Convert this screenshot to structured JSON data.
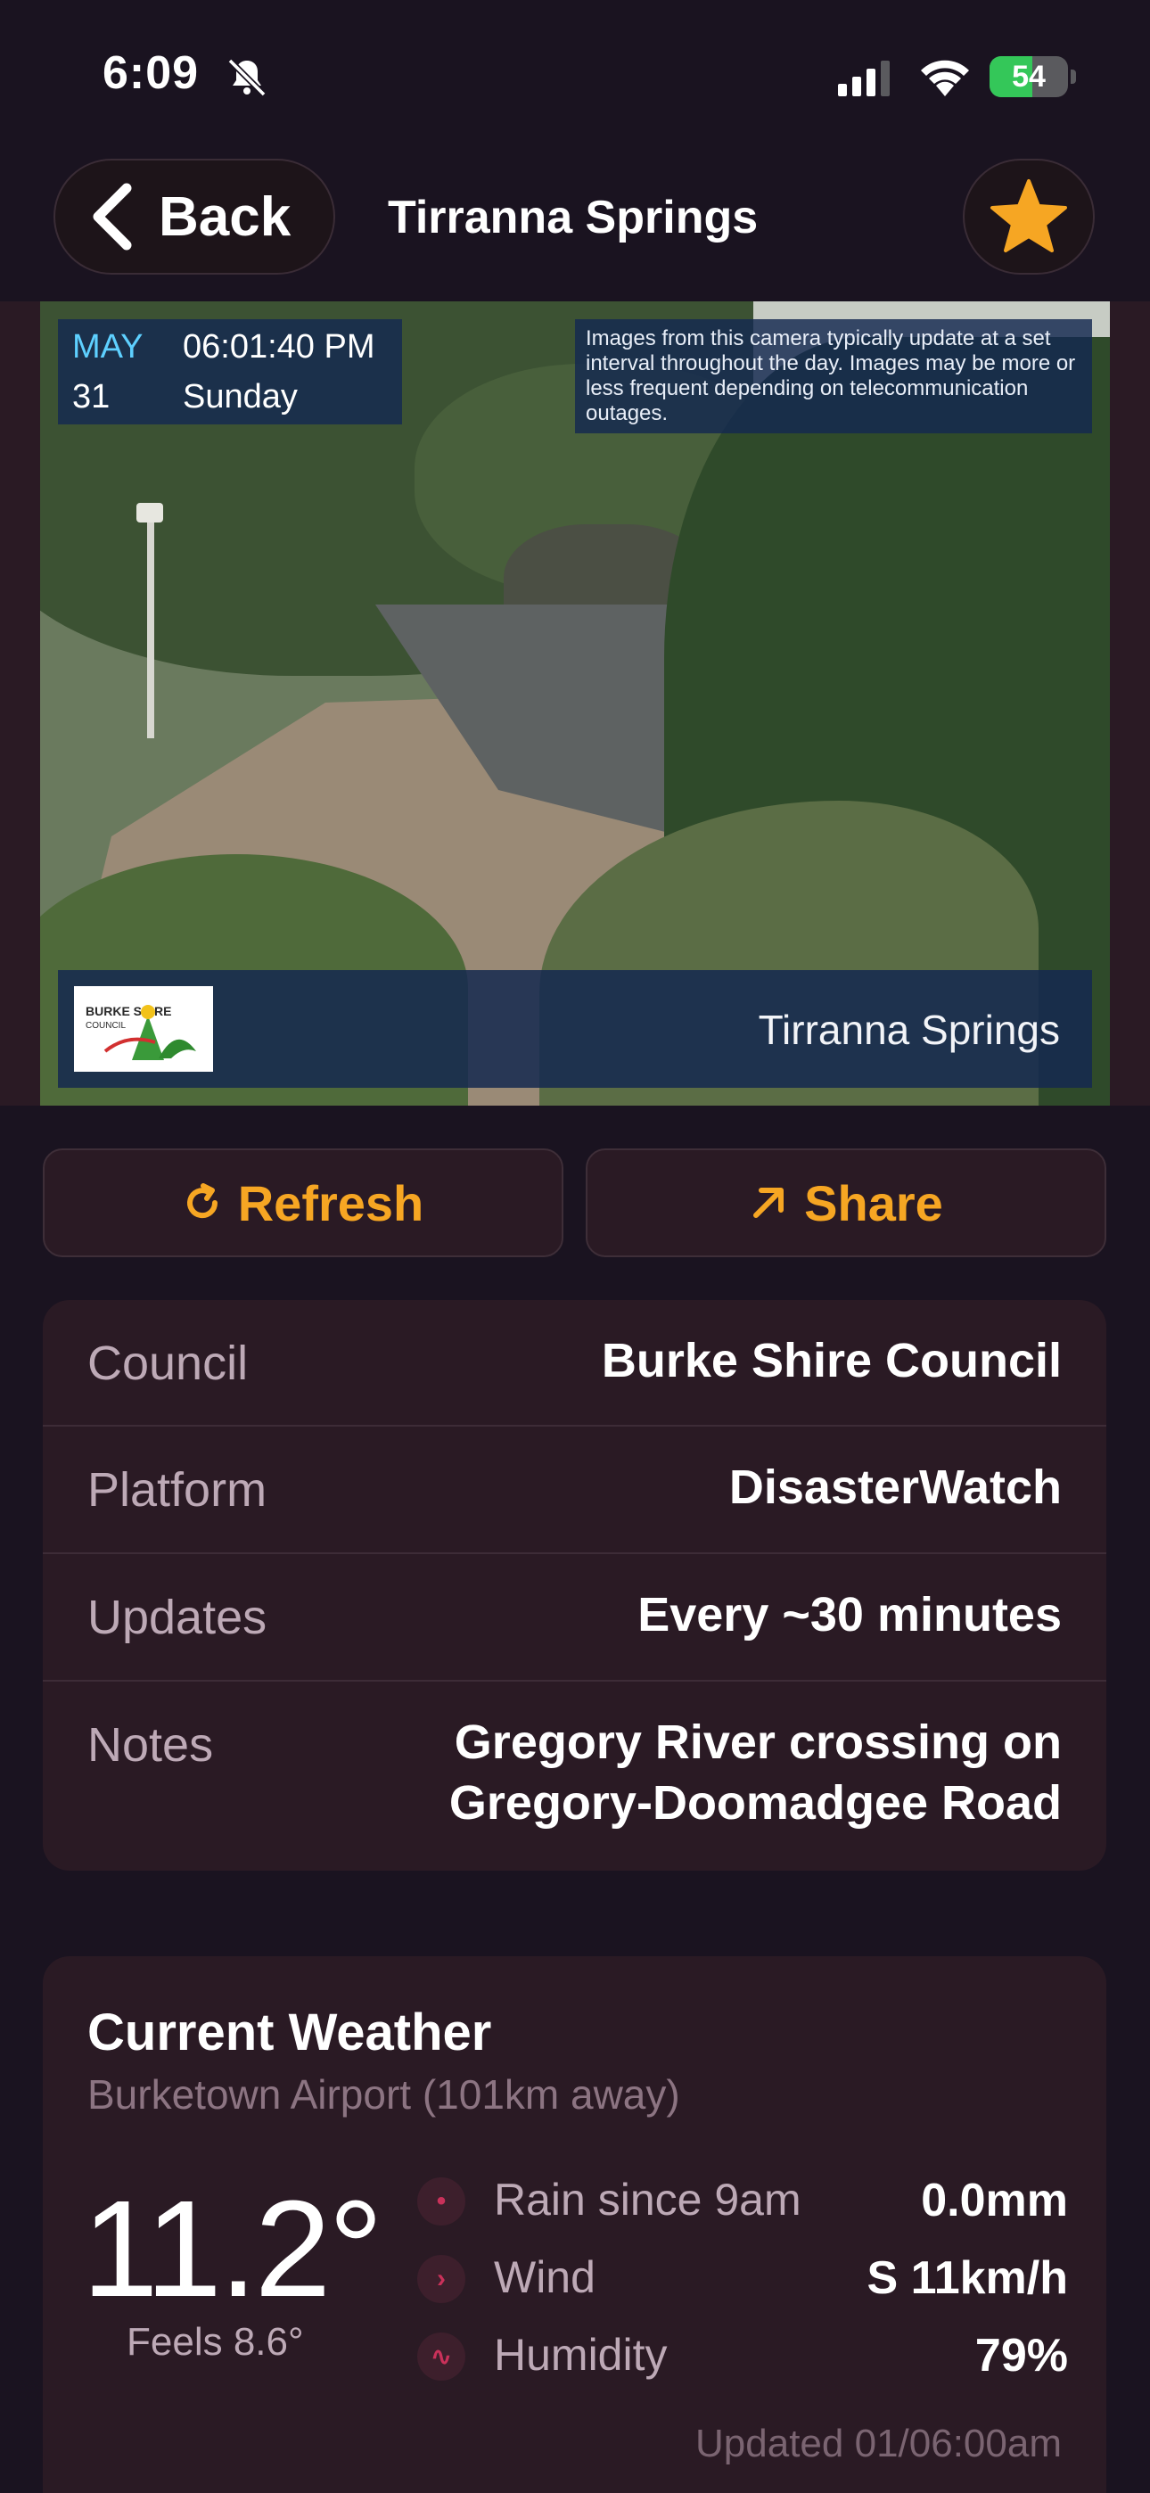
{
  "status_bar": {
    "time": "6:09",
    "battery": "54",
    "battery_level": 0.54
  },
  "nav": {
    "back_label": "Back",
    "title": "Tirranna Springs"
  },
  "camera": {
    "month": "MAY",
    "time": "06:01:40 PM",
    "day": "31",
    "weekday": "Sunday",
    "notice": "Images from this camera typically update at a set interval throughout the day. Images may be more or less frequent depending on telecommunication outages.",
    "logo_text": "BURKE SHIRE COUNCIL",
    "location": "Tirranna Springs"
  },
  "actions": {
    "refresh_label": "Refresh",
    "share_label": "Share"
  },
  "info": [
    {
      "label": "Council",
      "value": "Burke Shire Council"
    },
    {
      "label": "Platform",
      "value": "DisasterWatch"
    },
    {
      "label": "Updates",
      "value": "Every ~30 minutes"
    },
    {
      "label": "Notes",
      "value": "Gregory River crossing on Gregory-Doomadgee Road"
    }
  ],
  "weather": {
    "title": "Current Weather",
    "station": "Burketown Airport (101km away)",
    "temperature": "11.2°",
    "feels_like": "Feels 8.6°",
    "rows": [
      {
        "label": "Rain since 9am",
        "value": "0.0mm",
        "icon": "rain-icon"
      },
      {
        "label": "Wind",
        "value": "S 11km/h",
        "icon": "wind-icon"
      },
      {
        "label": "Humidity",
        "value": "79%",
        "icon": "humidity-icon"
      }
    ],
    "updated": "Updated 01/06:00am"
  },
  "colors": {
    "accent": "#f6a623",
    "background": "#1a1320",
    "card": "#2a1a24",
    "weather_icon": "#c9315a"
  }
}
